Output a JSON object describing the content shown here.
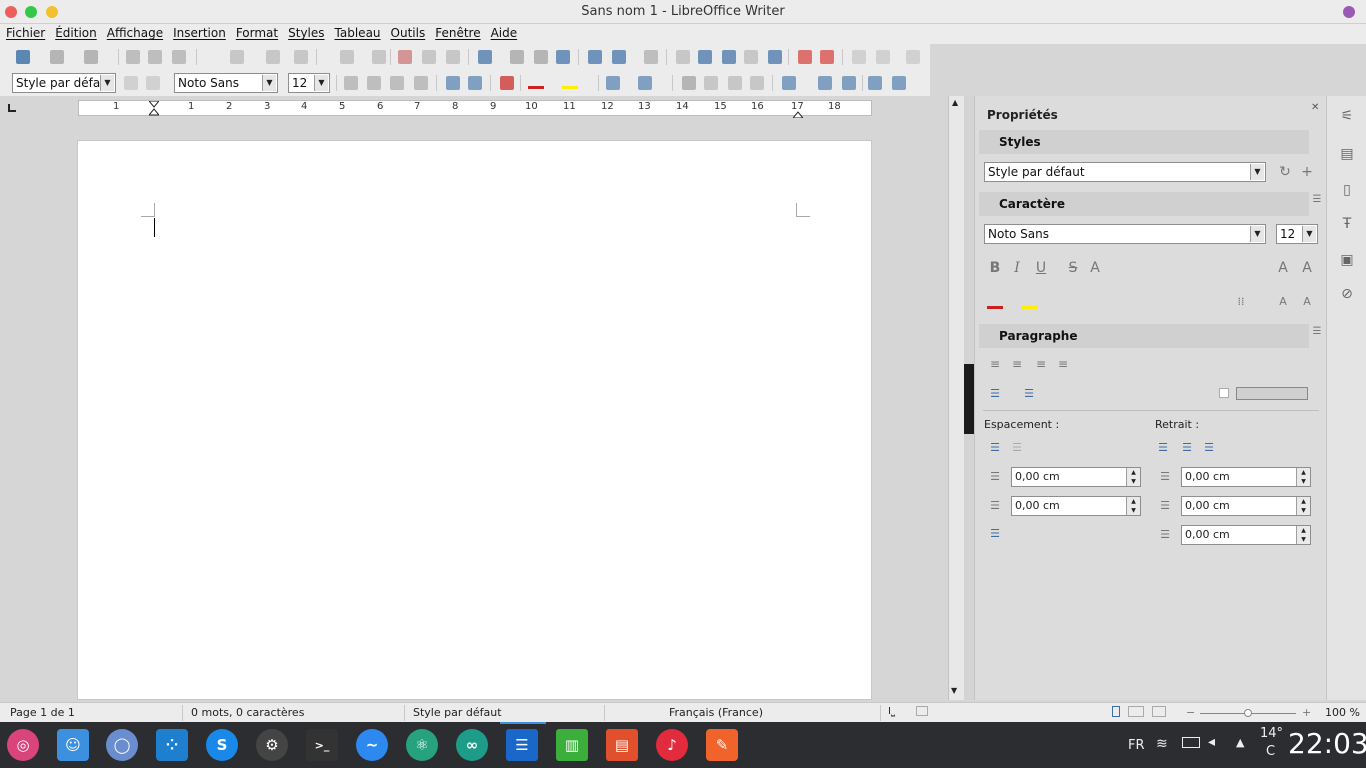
{
  "window": {
    "title": "Sans nom 1 - LibreOffice Writer"
  },
  "menu": [
    "Fichier",
    "Édition",
    "Affichage",
    "Insertion",
    "Format",
    "Styles",
    "Tableau",
    "Outils",
    "Fenêtre",
    "Aide"
  ],
  "format_bar": {
    "paragraph_style": "Style par défaut",
    "font_name": "Noto Sans",
    "font_size": "12"
  },
  "ruler": {
    "labels": [
      "1",
      "1",
      "2",
      "3",
      "4",
      "5",
      "6",
      "7",
      "8",
      "9",
      "10",
      "11",
      "12",
      "13",
      "14",
      "15",
      "16",
      "17",
      "18"
    ]
  },
  "sidebar": {
    "title": "Propriétés",
    "styles": {
      "header": "Styles",
      "value": "Style par défaut"
    },
    "character": {
      "header": "Caractère",
      "font": "Noto Sans",
      "size": "12"
    },
    "paragraph": {
      "header": "Paragraphe"
    },
    "spacing": {
      "label": "Espacement :",
      "above": "0,00 cm",
      "below": "0,00 cm"
    },
    "indent": {
      "label": "Retrait :",
      "before": "0,00 cm",
      "after": "0,00 cm",
      "first_line": "0,00 cm"
    }
  },
  "status": {
    "page": "Page 1 de 1",
    "words": "0 mots, 0 caractères",
    "style": "Style par défaut",
    "language": "Français (France)",
    "zoom": "100 %"
  },
  "taskbar": {
    "lang": "FR",
    "temp": "14°",
    "temp_unit": "C",
    "time": "22:03"
  },
  "colors": {
    "accent_red": "#c9211e",
    "accent_yellow": "#ffee00",
    "taskbar_bg": "#2b2d30"
  }
}
